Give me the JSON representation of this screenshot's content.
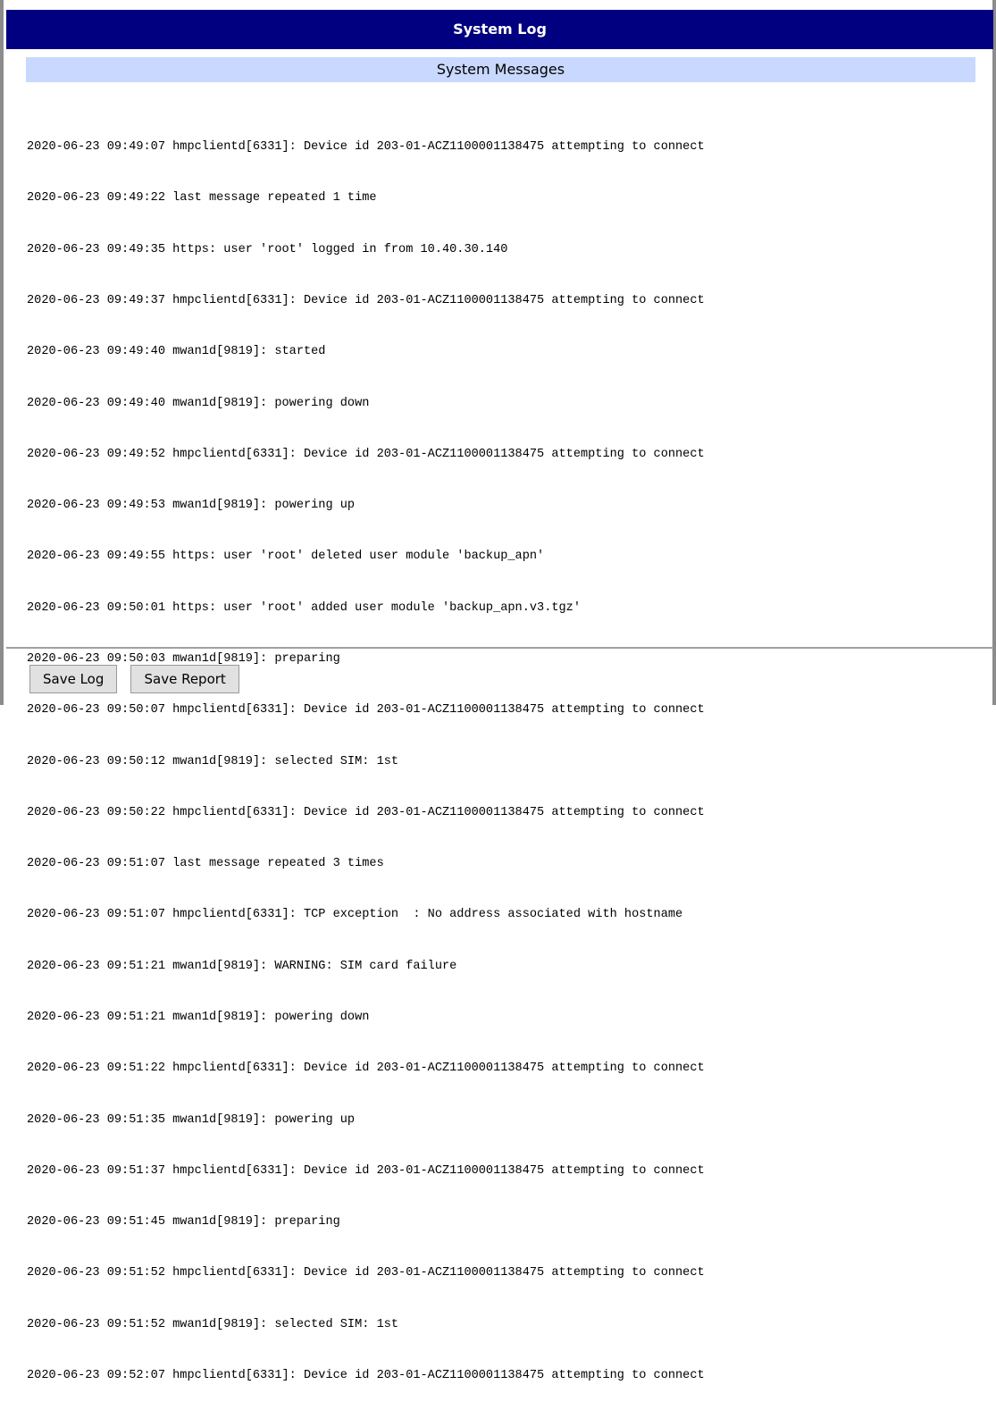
{
  "window": {
    "title": "System Log"
  },
  "section": {
    "title": "System Messages"
  },
  "log": {
    "lines": [
      "2020-06-23 09:49:07 hmpclientd[6331]: Device id 203-01-ACZ1100001138475 attempting to connect",
      "2020-06-23 09:49:22 last message repeated 1 time",
      "2020-06-23 09:49:35 https: user 'root' logged in from 10.40.30.140",
      "2020-06-23 09:49:37 hmpclientd[6331]: Device id 203-01-ACZ1100001138475 attempting to connect",
      "2020-06-23 09:49:40 mwan1d[9819]: started",
      "2020-06-23 09:49:40 mwan1d[9819]: powering down",
      "2020-06-23 09:49:52 hmpclientd[6331]: Device id 203-01-ACZ1100001138475 attempting to connect",
      "2020-06-23 09:49:53 mwan1d[9819]: powering up",
      "2020-06-23 09:49:55 https: user 'root' deleted user module 'backup_apn'",
      "2020-06-23 09:50:01 https: user 'root' added user module 'backup_apn.v3.tgz'",
      "2020-06-23 09:50:03 mwan1d[9819]: preparing",
      "2020-06-23 09:50:07 hmpclientd[6331]: Device id 203-01-ACZ1100001138475 attempting to connect",
      "2020-06-23 09:50:12 mwan1d[9819]: selected SIM: 1st",
      "2020-06-23 09:50:22 hmpclientd[6331]: Device id 203-01-ACZ1100001138475 attempting to connect",
      "2020-06-23 09:51:07 last message repeated 3 times",
      "2020-06-23 09:51:07 hmpclientd[6331]: TCP exception  : No address associated with hostname",
      "2020-06-23 09:51:21 mwan1d[9819]: WARNING: SIM card failure",
      "2020-06-23 09:51:21 mwan1d[9819]: powering down",
      "2020-06-23 09:51:22 hmpclientd[6331]: Device id 203-01-ACZ1100001138475 attempting to connect",
      "2020-06-23 09:51:35 mwan1d[9819]: powering up",
      "2020-06-23 09:51:37 hmpclientd[6331]: Device id 203-01-ACZ1100001138475 attempting to connect",
      "2020-06-23 09:51:45 mwan1d[9819]: preparing",
      "2020-06-23 09:51:52 hmpclientd[6331]: Device id 203-01-ACZ1100001138475 attempting to connect",
      "2020-06-23 09:51:52 mwan1d[9819]: selected SIM: 1st",
      "2020-06-23 09:52:07 hmpclientd[6331]: Device id 203-01-ACZ1100001138475 attempting to connect"
    ]
  },
  "buttons": {
    "save_log": "Save Log",
    "save_report": "Save Report"
  },
  "colors": {
    "title_bar": "#000080",
    "section_header": "#c8d8ff",
    "button_face": "#e1e1e1"
  }
}
